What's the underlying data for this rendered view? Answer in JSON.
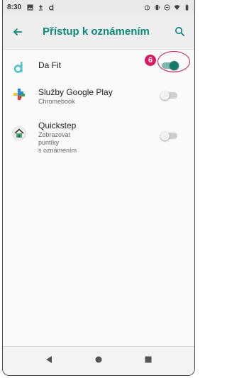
{
  "status_bar": {
    "time": "8:30",
    "left_icons": [
      "image-icon",
      "upload-icon",
      "d-app-icon"
    ],
    "right_icons": [
      "alarm-icon",
      "vibrate-icon",
      "dnd-icon",
      "wifi-icon",
      "battery-icon"
    ]
  },
  "toolbar": {
    "title": "Přístup k oznámením",
    "back_icon": "arrow-back-icon",
    "search_icon": "search-icon"
  },
  "apps": [
    {
      "name": "Da Fit",
      "subtitle": "",
      "icon": "dafit-icon",
      "enabled": true
    },
    {
      "name": "Služby Google Play",
      "subtitle": "Chromebook",
      "icon": "play-services-icon",
      "enabled": false
    },
    {
      "name": "Quickstep",
      "subtitle": "Zobrazovat\npuntíky\ns oznámením",
      "icon": "home-icon",
      "enabled": false
    }
  ],
  "annotation": {
    "badge": "6",
    "color": "#d81b60"
  },
  "colors": {
    "accent": "#0f8a7a",
    "toggle_on": "#137a6c"
  },
  "nav_bar": [
    "back-triangle-icon",
    "home-circle-icon",
    "recents-square-icon"
  ]
}
